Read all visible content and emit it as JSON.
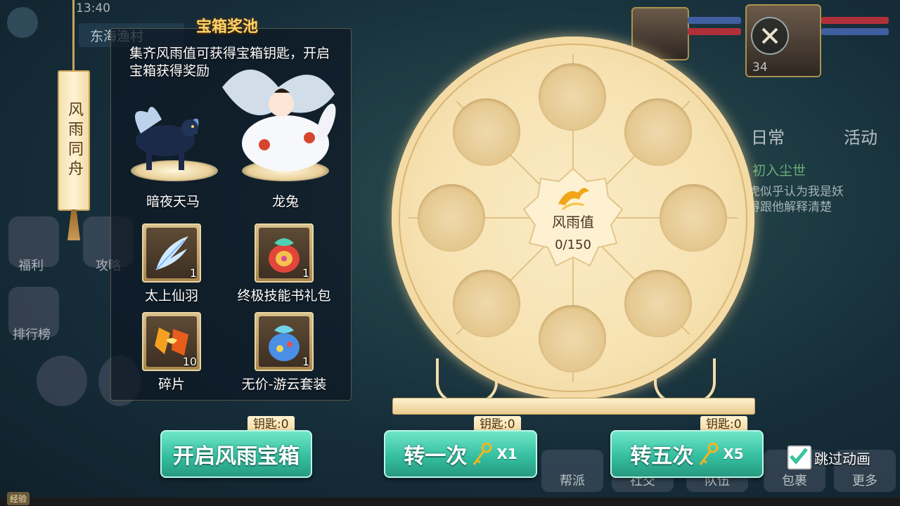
{
  "hud": {
    "time": "13:40",
    "location": "东海渔村",
    "player_level": "34",
    "tabs": [
      "日常",
      "活动"
    ],
    "quest_title": "初入尘世",
    "quest_lines": [
      "虎似乎认为我是妖",
      "得跟他解释清楚"
    ],
    "side_labels": [
      "福利",
      "攻略",
      "排行榜"
    ],
    "bottom_buttons": [
      "帮派",
      "社交",
      "队伍",
      "包裹",
      "更多"
    ],
    "exp_label": "经验"
  },
  "banner": {
    "text": "风雨同舟"
  },
  "pool": {
    "title": "宝箱奖池",
    "description": "集齐风雨值可获得宝箱钥匙，开启宝箱获得奖励",
    "pets": [
      {
        "name": "暗夜天马",
        "icon": "dark-pegasus-icon"
      },
      {
        "name": "龙兔",
        "icon": "dragon-rabbit-icon"
      }
    ],
    "items": [
      {
        "name": "太上仙羽",
        "count": "1",
        "icon": "feather-icon"
      },
      {
        "name": "终极技能书礼包",
        "count": "1",
        "icon": "skill-book-bag-icon"
      },
      {
        "name": "碎片",
        "count": "10",
        "icon": "fragment-icon"
      },
      {
        "name": "无价-游云套装",
        "count": "1",
        "icon": "costume-bag-icon"
      }
    ]
  },
  "wheel": {
    "label": "风雨值",
    "value": "0/150",
    "slot_count": 8
  },
  "actions": {
    "open_chest": {
      "tag": "钥匙:0",
      "label": "开启风雨宝箱"
    },
    "spin_once": {
      "tag": "钥匙:0",
      "label": "转一次",
      "mult": "X1"
    },
    "spin_five": {
      "tag": "钥匙:0",
      "label": "转五次",
      "mult": "X5"
    },
    "skip_animation": {
      "label": "跳过动画",
      "checked": true
    }
  },
  "colors": {
    "accent_gold": "#ffd36a",
    "button_teal": "#35bfa0",
    "wheel_cream": "#f6e1b0"
  }
}
